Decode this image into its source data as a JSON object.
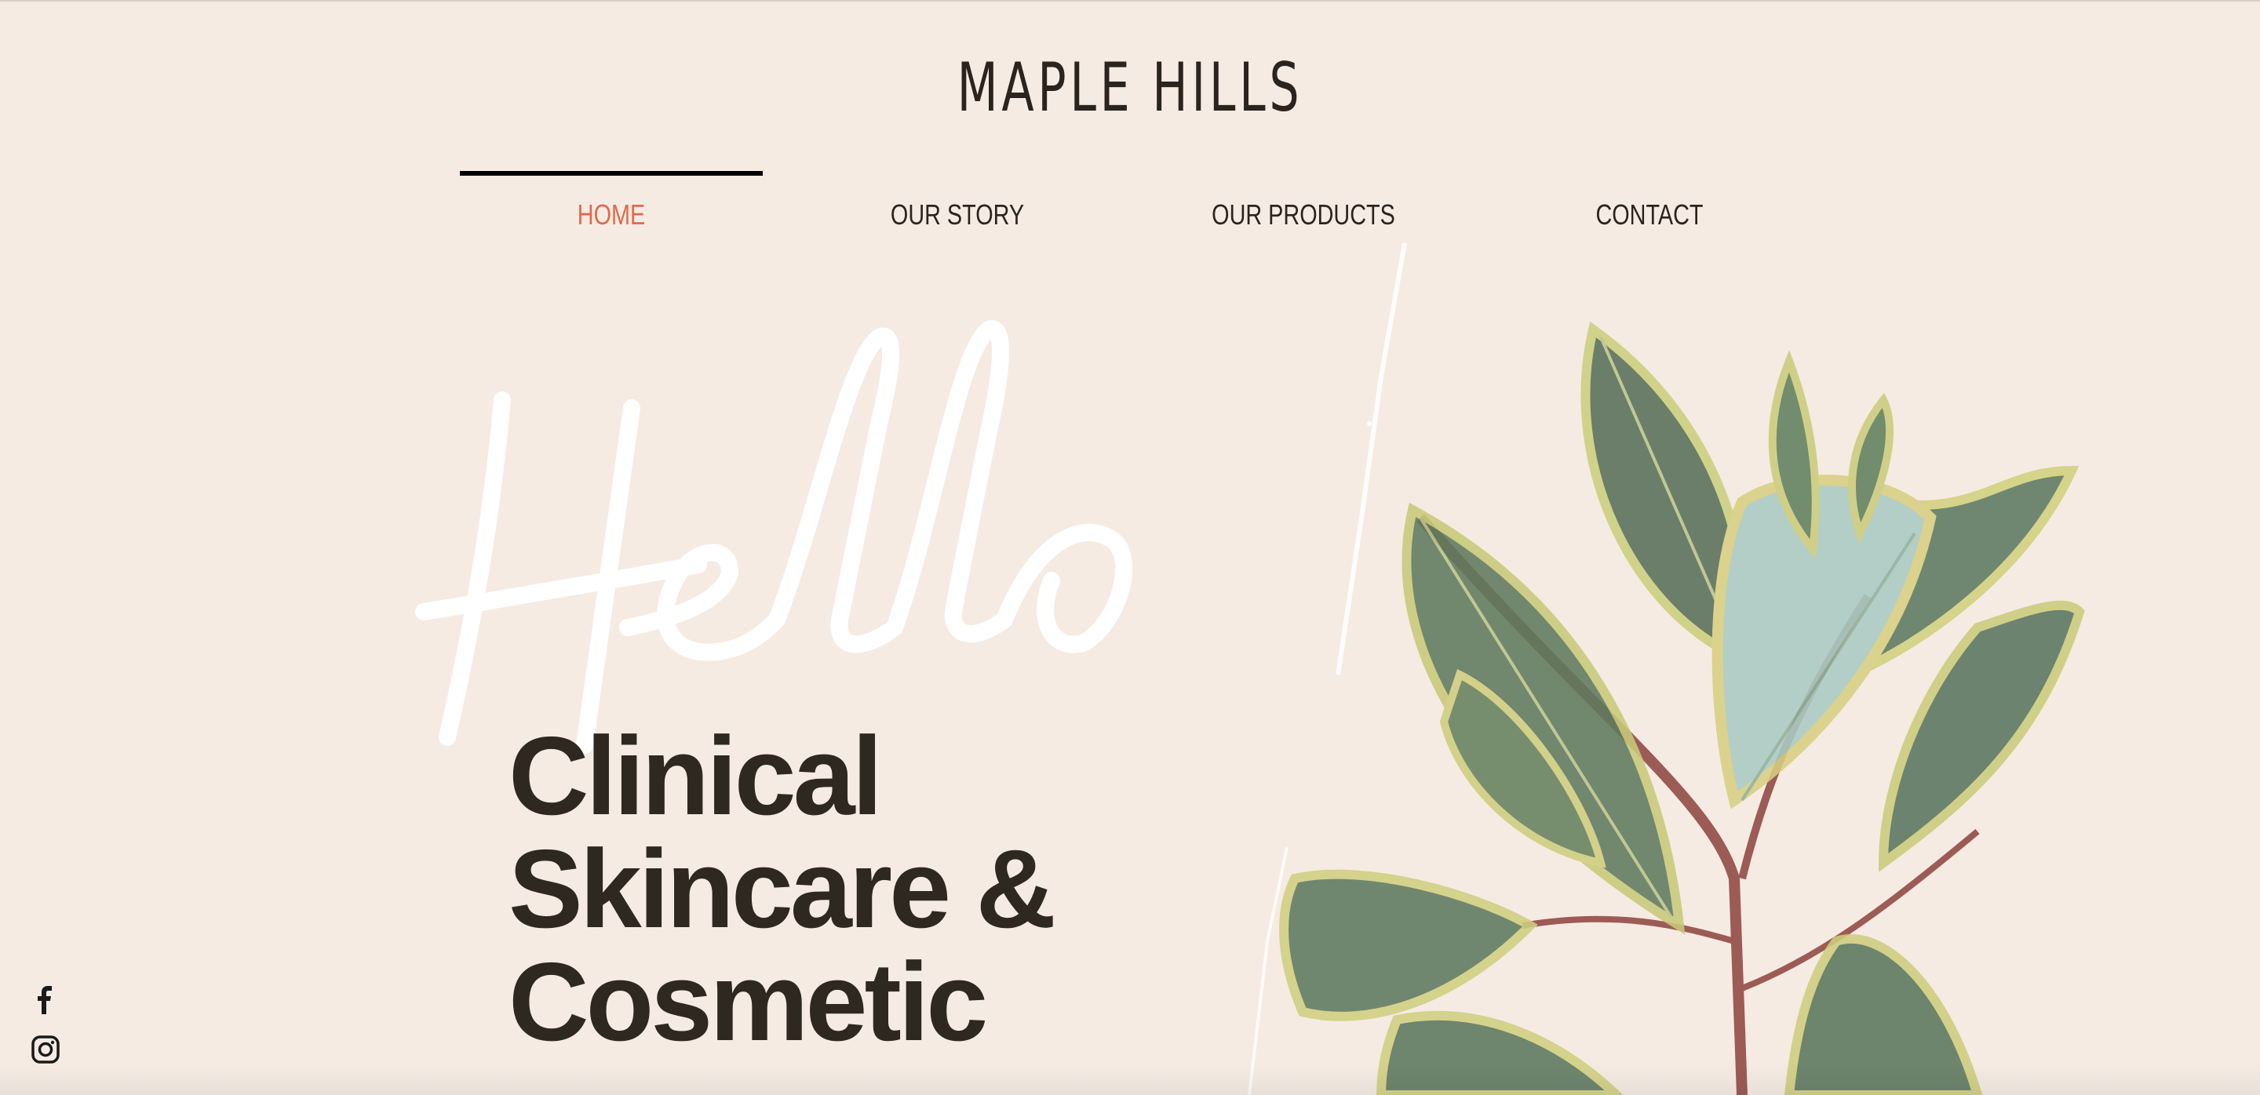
{
  "site": {
    "logo": "MAPLE HILLS"
  },
  "nav": {
    "items": [
      {
        "label": "HOME",
        "active": true
      },
      {
        "label": "OUR STORY",
        "active": false
      },
      {
        "label": "OUR PRODUCTS",
        "active": false
      },
      {
        "label": "CONTACT",
        "active": false
      }
    ],
    "active_color": "#e0694a",
    "underline_color": "#000000"
  },
  "hero": {
    "script_word": "Hello",
    "headline": [
      "Clinical",
      "Skincare &",
      "Cosmetic"
    ],
    "text_color": "#2f2820",
    "background_color": "#f5ebe3"
  },
  "social": {
    "icons": [
      "facebook-icon",
      "instagram-icon"
    ]
  }
}
